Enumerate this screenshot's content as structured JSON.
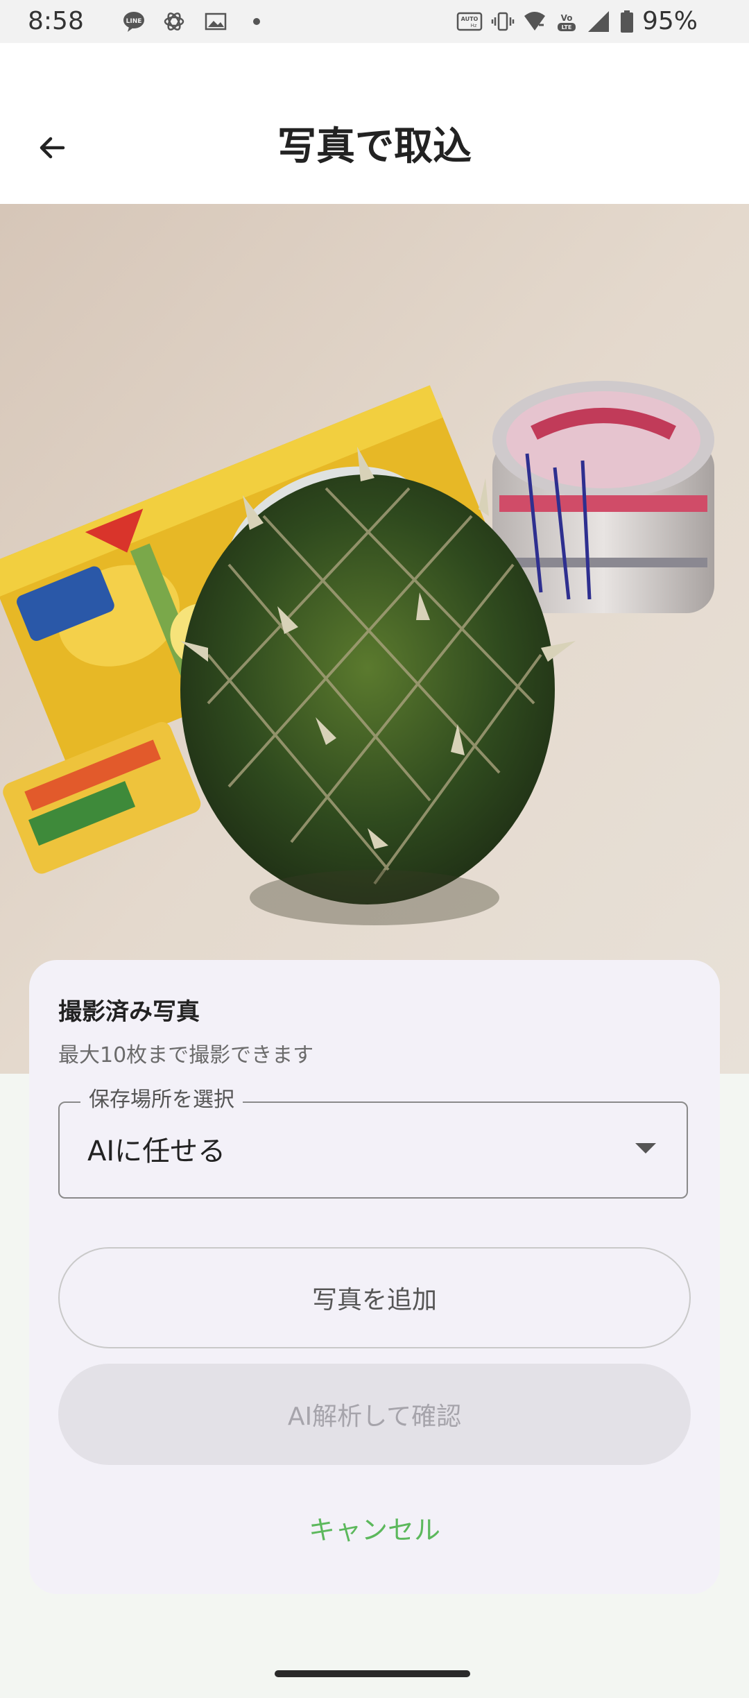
{
  "status_bar": {
    "time": "8:58",
    "battery_percent": "95%",
    "left_icons": [
      "line-icon",
      "openai-icon",
      "gallery-icon",
      "dot-icon"
    ],
    "right_icons": [
      "auto-hz-icon",
      "vibrate-icon",
      "wifi-icon",
      "volte-icon",
      "signal-icon",
      "battery-icon"
    ]
  },
  "app_bar": {
    "title": "写真で取込",
    "back_icon": "arrow-left-icon"
  },
  "sheet": {
    "title": "撮影済み写真",
    "subtitle": "最大10枚まで撮影できます",
    "location_select": {
      "label": "保存場所を選択",
      "value": "AIに任せる"
    },
    "add_photo_label": "写真を追加",
    "analyze_label": "AI解析して確認",
    "cancel_label": "キャンセル"
  },
  "colors": {
    "accent_green": "#5cb85c",
    "sheet_bg": "#f3f1f8",
    "disabled_button": "#e3e1e7"
  }
}
